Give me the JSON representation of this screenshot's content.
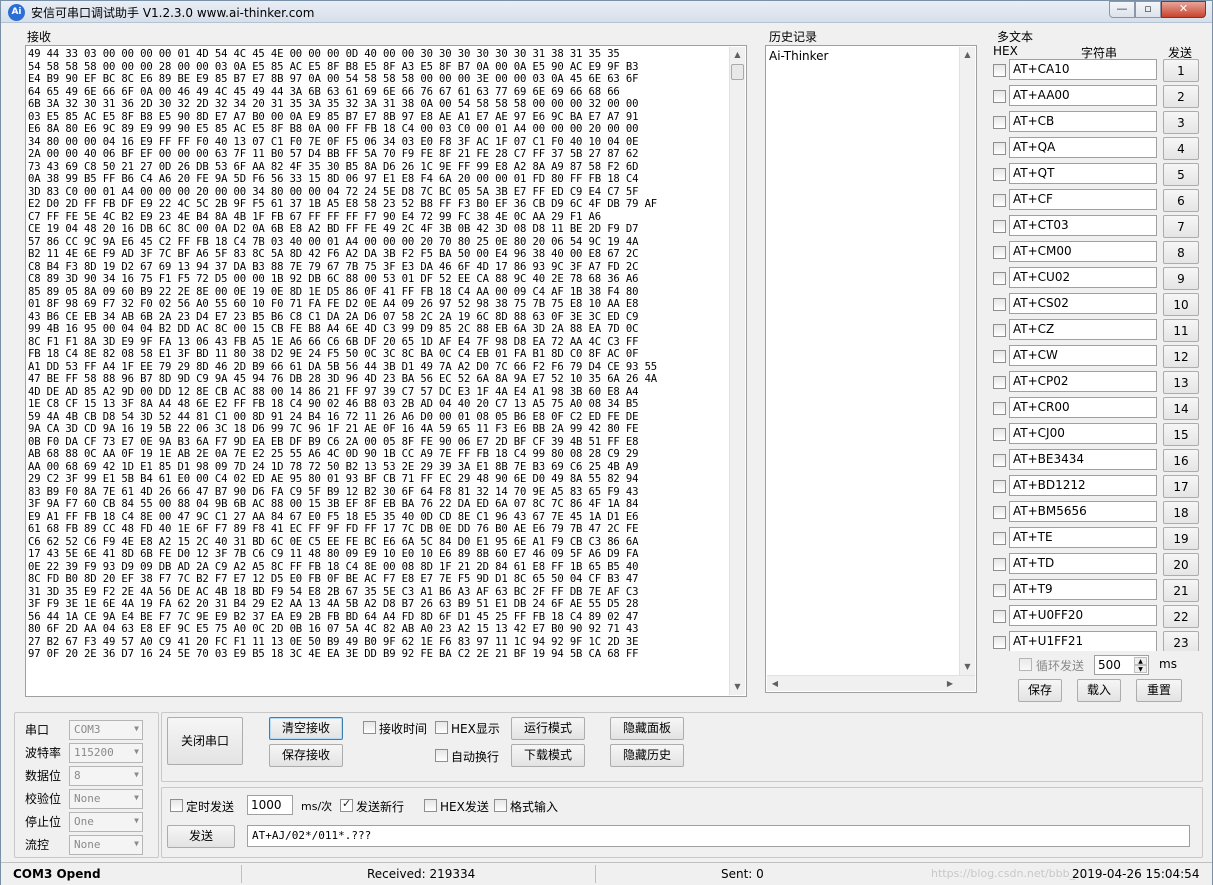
{
  "title": {
    "icon": "Ai",
    "text": "安信可串口调试助手 V1.2.3.0    www.ai-thinker.com"
  },
  "window_controls": {
    "minimize": "—",
    "maximize": "▫",
    "close": "✕"
  },
  "receive": {
    "label": "接收",
    "content": "49 44 33 03 00 00 00 00 01 4D 54 4C 45 4E 00 00 00 0D 40 00 00 30 30 30 30 30 30 31 38 31 35 35\n54 58 58 58 00 00 00 28 00 00 03 0A E5 85 AC E5 8F B8 E5 8F A3 E5 8F B7 0A 00 0A E5 90 AC E9 9F B3\nE4 B9 90 EF BC 8C E6 89 BE E9 85 B7 E7 8B 97 0A 00 54 58 58 58 00 00 00 3E 00 00 03 0A 45 6E 63 6F\n64 65 49 6E 66 6F 0A 00 46 49 4C 45 49 44 3A 6B 63 61 69 6E 66 76 67 61 63 77 69 6E 69 66 68 66\n6B 3A 32 30 31 36 2D 30 32 2D 32 34 20 31 35 3A 35 32 3A 31 38 0A 00 54 58 58 58 00 00 00 32 00 00\n03 E5 85 AC E5 8F B8 E5 90 8D E7 A7 B0 00 0A E9 85 B7 E7 8B 97 E8 AE A1 E7 AE 97 E6 9C BA E7 A7 91\nE6 8A 80 E6 9C 89 E9 99 90 E5 85 AC E5 8F B8 0A 00 FF FB 18 C4 00 03 C0 00 01 A4 00 00 00 20 00 00\n34 80 00 00 04 16 E9 FF FF F0 40 13 07 C1 F0 7E 0F F5 06 34 03 E0 F8 3F AC 1F 07 C1 F0 40 10 04 0E\n2A 00 00 40 06 BF EF 00 00 00 63 7F 11 B0 57 D4 BB FF 5A 70 F9 FE 8F 21 FE 28 C7 FF 37 5B 27 87 62\n73 43 69 C8 50 21 27 0D 26 DB 53 6F AA 82 4F 35 30 B5 8A D6 26 1C 9E FF 99 E8 A2 8A A9 87 58 F2 6D\n0A 38 99 B5 FF B6 C4 A6 20 FE 9A 5D F6 56 33 15 8D 06 97 E1 E8 F4 6A 20 00 00 01 FD 80 FF FB 18 C4\n3D 83 C0 00 01 A4 00 00 00 20 00 00 34 80 00 00 04 72 24 5E D8 7C BC 05 5A 3B E7 FF ED C9 E4 C7 5F\nE2 D0 2D FF FB DF E9 22 4C 5C 2B 9F F5 61 37 1B A5 E8 58 23 52 B8 FF F3 B0 EF 36 CB D9 6C 4F DB 79 AF\nC7 FF FE 5E 4C B2 E9 23 4E B4 8A 4B 1F FB 67 FF FF FF F7 90 E4 72 99 FC 38 4E 0C AA 29 F1 A6\nCE 19 04 48 20 16 DB 6C 8C 00 0A D2 0A 6B E8 A2 BD FF FE 49 2C 4F 3B 0B 42 3D 08 D8 11 BE 2D F9 D7\n57 86 CC 9C 9A E6 45 C2 FF FB 18 C4 7B 03 40 00 01 A4 00 00 00 20 70 80 25 0E 80 20 06 54 9C 19 4A\nB2 11 4E 6E F9 AD 3F 7C BF A6 5F 83 8C 5A 8D 42 F6 A2 DA 3B F2 F5 BA 50 00 E4 96 38 40 00 E8 67 2C\nC8 B4 F3 8D 19 D2 67 69 13 94 37 DA B3 88 7E 79 67 7B 75 3F E3 DA 46 6F 4D 17 86 93 9C 3F A7 FD 2C\nC8 89 3D 90 34 16 75 F1 F5 72 D5 00 00 1B 92 DB 6C 88 00 53 01 DF 52 EE CA 88 9C 40 2E 78 68 36 A6\n85 89 05 8A 09 60 B9 22 2E 8E 00 0E 19 0E 8D 1E D5 86 0F 41 FF FB 18 C4 AA 00 09 C4 AF 1B 38 F4 80\n01 8F 98 69 F7 32 F0 02 56 A0 55 60 10 F0 71 FA FE D2 0E A4 09 26 97 52 98 38 75 7B 75 E8 10 AA E8\n43 B6 CE EB 34 AB 6B 2A 23 D4 E7 23 B5 B6 C8 C1 DA 2A D6 07 58 2C 2A 19 6C 8D 88 63 0F 3E 3C ED C9\n99 4B 16 95 00 04 04 B2 DD AC 8C 00 15 CB FE B8 A4 6E 4D C3 99 D9 85 2C 88 EB 6A 3D 2A 88 EA 7D 0C\n8C F1 F1 8A 3D E9 9F FA 13 06 43 FB A5 1E A6 66 C6 6B DF 20 65 1D AF E4 7F 98 D8 EA 72 AA 4C C3 FF\nFB 18 C4 8E 82 08 58 E1 3F BD 11 80 38 D2 9E 24 F5 50 0C 3C 8C BA 0C C4 EB 01 FA B1 8D C0 8F AC 0F\nA1 DD 53 FF A4 1F EE 79 29 8D 46 2D B9 66 61 DA 5B 56 44 3B D1 49 7A A2 D0 7C 66 F2 F6 79 D4 CE 93 55\n47 BE FF 58 88 96 B7 8D 9D C9 9A 45 94 76 DB 28 3D 96 4D 23 BA 56 EC 52 6A 8A 9A E7 52 10 35 6A 26 4A\n4D DE AD 85 A2 9D 00 DD 12 8E CB AC 88 00 14 86 21 FF 97 39 C7 57 DC E3 1F 4A E4 A1 98 3B 60 E8 A4\n1E C8 CF 15 13 3F 8A A4 48 6E E2 FF FB 18 C4 90 02 46 B8 03 2B AD 04 40 20 C7 13 A5 75 A0 08 34 B5\n59 4A 4B CB D8 54 3D 52 44 81 C1 00 8D 91 24 B4 16 72 11 26 A6 D0 00 01 08 05 B6 E8 0F C2 ED FE DE\n9A CA 3D CD 9A 16 19 5B 22 06 3C 18 D6 99 7C 96 1F 21 AE 0F 16 4A 59 65 11 F3 E6 BB 2A 99 42 80 FE\n0B F0 DA CF 73 E7 0E 9A B3 6A F7 9D EA EB DF B9 C6 2A 00 05 8F FE 90 06 E7 2D BF CF 39 4B 51 FF E8\nAB 68 88 0C AA 0F 19 1E AB 2E 0A 7E E2 25 55 A6 4C 0D 90 1B CC A9 7E FF FB 18 C4 99 80 08 28 C9 29\nAA 00 68 69 42 1D E1 85 D1 98 09 7D 24 1D 78 72 50 B2 13 53 2E 29 39 3A E1 8B 7E B3 69 C6 25 4B A9\n29 C2 3F 99 E1 5B B4 61 E0 00 C4 02 ED AE 95 80 01 93 BF CB 71 FF EC 29 48 90 6E D0 49 8A 55 82 94\n83 B9 F0 8A 7E 61 4D 26 66 47 B7 90 D6 FA C9 5F B9 12 B2 30 6F 64 F8 81 32 14 70 9E A5 83 65 F9 43\n3F 9A F7 60 CB 84 55 00 88 04 9B 6B AC 88 00 15 3B EF 8F EB BA 76 22 DA ED 6A 07 8C 7C 86 4F 1A 84\nE9 A1 FF FB 18 C4 8E 00 47 9C C1 27 AA 84 67 E0 F5 18 E5 35 40 0D CD 8E C1 96 43 67 7E 45 1A D1 E6\n61 68 FB 89 CC 48 FD 40 1E 6F F7 89 F8 41 EC FF 9F FD FF 17 7C DB 0E DD 76 B0 AE E6 79 7B 47 2C FE\nC6 62 52 C6 F9 4E E8 A2 15 2C 40 31 BD 6C 0E C5 EE FE BC E6 6A 5C 84 D0 E1 95 6E A1 F9 CB C3 86 6A\n17 43 5E 6E 41 8D 6B FE D0 12 3F 7B C6 C9 11 48 80 09 E9 10 E0 10 E6 89 8B 60 E7 46 09 5F A6 D9 FA\n0E 22 39 F9 93 D9 09 DB AD 2A C9 A2 A5 8C FF FB 18 C4 8E 00 08 8D 1F 21 2D 84 61 E8 FF 1B 65 B5 40\n8C FD B0 8D 20 EF 38 F7 7C B2 F7 E7 12 D5 E0 FB 0F BE AC F7 E8 E7 7E F5 9D D1 8C 65 50 04 CF B3 47\n31 3D 35 E9 F2 2E 4A 56 DE AC 4B 18 BD F9 54 E8 2B 67 35 5E C3 A1 B6 A3 AF 63 BC 2F FF DB 7E AF C3\n3F F9 3E 1E 6E 4A 19 FA 62 20 31 B4 29 E2 AA 13 4A 5B A2 D8 B7 26 63 B9 51 E1 DB 24 6F AE 55 D5 28\n56 44 1A CE 9A E4 BE F7 7C 9E E9 B2 37 EA E9 2B FB BD 64 A4 FD 8D 6F D1 45 25 FF FB 18 C4 89 02 47\n80 6F 2D AA 04 63 E8 EF 9C E5 75 A0 0C 2D 0B 16 07 5A 4C 82 AB A0 23 A2 15 13 42 E7 B0 90 92 71 43\n27 B2 67 F3 49 57 A0 C9 41 20 FC F1 11 13 0E 50 B9 49 B0 9F 62 1E F6 83 97 11 1C 94 92 9F 1C 2D 3E\n97 0F 20 2E 36 D7 16 24 5E 70 03 E9 B5 18 3C 4E EA 3E DD B9 92 FE BA C2 2E 21 BF 19 94 5B CA 68 FF"
  },
  "history": {
    "label": "历史记录",
    "items": [
      "Ai-Thinker"
    ]
  },
  "multi": {
    "label": "多文本",
    "col_hex": "HEX",
    "col_string": "字符串",
    "col_send": "发送",
    "items": [
      {
        "text": "AT+CA10",
        "num": "1"
      },
      {
        "text": "AT+AA00",
        "num": "2"
      },
      {
        "text": "AT+CB",
        "num": "3"
      },
      {
        "text": "AT+QA",
        "num": "4"
      },
      {
        "text": "AT+QT",
        "num": "5"
      },
      {
        "text": "AT+CF",
        "num": "6"
      },
      {
        "text": "AT+CT03",
        "num": "7"
      },
      {
        "text": "AT+CM00",
        "num": "8"
      },
      {
        "text": "AT+CU02",
        "num": "9"
      },
      {
        "text": "AT+CS02",
        "num": "10"
      },
      {
        "text": "AT+CZ",
        "num": "11"
      },
      {
        "text": "AT+CW",
        "num": "12"
      },
      {
        "text": "AT+CP02",
        "num": "13"
      },
      {
        "text": "AT+CR00",
        "num": "14"
      },
      {
        "text": "AT+CJ00",
        "num": "15"
      },
      {
        "text": "AT+BE3434",
        "num": "16"
      },
      {
        "text": "AT+BD1212",
        "num": "17"
      },
      {
        "text": "AT+BM5656",
        "num": "18"
      },
      {
        "text": "AT+TE",
        "num": "19"
      },
      {
        "text": "AT+TD",
        "num": "20"
      },
      {
        "text": "AT+T9",
        "num": "21"
      },
      {
        "text": "AT+U0FF20",
        "num": "22"
      },
      {
        "text": "AT+U1FF21",
        "num": "23"
      }
    ],
    "loop_label": "循环发送",
    "loop_value": "500",
    "loop_unit": "ms",
    "save": "保存",
    "load": "载入",
    "reset": "重置"
  },
  "port": {
    "port_label": "串口",
    "port_value": "COM3",
    "baud_label": "波特率",
    "baud_value": "115200",
    "data_label": "数据位",
    "data_value": "8",
    "parity_label": "校验位",
    "parity_value": "None",
    "stop_label": "停止位",
    "stop_value": "One",
    "flow_label": "流控",
    "flow_value": "None"
  },
  "controls": {
    "close_port": "关闭串口",
    "clear_recv": "清空接收",
    "save_recv": "保存接收",
    "recv_time": "接收时间",
    "hex_display": "HEX显示",
    "auto_newline": "自动换行",
    "run_mode": "运行模式",
    "download_mode": "下载模式",
    "hide_panel": "隐藏面板",
    "hide_history": "隐藏历史"
  },
  "send": {
    "timed": "定时发送",
    "interval": "1000",
    "interval_unit": "ms/次",
    "send_newline": "发送新行",
    "hex_send": "HEX发送",
    "format_input": "格式输入",
    "send_button": "发送",
    "input_value": "AT+AJ/02*/011*.???"
  },
  "status": {
    "port_status": "COM3 Opend",
    "received": "Received: 219334",
    "sent": "Sent: 0",
    "datetime": "2019-04-26 15:04:54",
    "watermark": "https://blog.csdn.net/bbb_..."
  }
}
